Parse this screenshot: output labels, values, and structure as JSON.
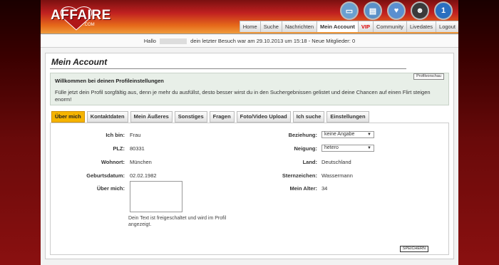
{
  "logo": {
    "text": "AFFAIRE",
    "sub": ".COM"
  },
  "top_icons": [
    {
      "icon": "monitor-icon",
      "color": "#6aa0d0"
    },
    {
      "icon": "document-icon",
      "color": "#5a90c8"
    },
    {
      "icon": "heart-icon",
      "color": "#5a8fd0"
    },
    {
      "icon": "people-icon",
      "color": "#3a3a3a"
    },
    {
      "icon": "notification-icon",
      "color": "#2a6fc0",
      "badge": "1"
    }
  ],
  "nav": [
    {
      "label": "Home"
    },
    {
      "label": "Suche"
    },
    {
      "label": "Nachrichten"
    },
    {
      "label": "Mein Account",
      "active": true
    },
    {
      "label": "VIP",
      "vip": true
    },
    {
      "label": "Community"
    },
    {
      "label": "Livedates"
    },
    {
      "label": "Logout"
    }
  ],
  "welcome": {
    "prefix": "Hallo",
    "suffix": "dein letzter Besuch war am 29.10.2013 um 15:18 - Neue Mitglieder: 0"
  },
  "page_title": "Mein Account",
  "info": {
    "title": "Willkommen bei deinen Profileinstellungen",
    "text": "Fülle jetzt dein Profil sorgfältig aus, denn je mehr du ausfüllst, desto besser wirst du in den Suchergebnissen gelistet und deine Chancen auf einen Flirt steigen enorm!",
    "preview_button": "Profilvorschau"
  },
  "tabs": [
    {
      "label": "Über mich",
      "active": true
    },
    {
      "label": "Kontaktdaten"
    },
    {
      "label": "Mein Äußeres"
    },
    {
      "label": "Sonstiges"
    },
    {
      "label": "Fragen"
    },
    {
      "label": "Foto/Video Upload"
    },
    {
      "label": "Ich suche"
    },
    {
      "label": "Einstellungen"
    }
  ],
  "form_left": [
    {
      "label": "Ich bin:",
      "value": "Frau"
    },
    {
      "label": "PLZ:",
      "value": "80331"
    },
    {
      "label": "Wohnort:",
      "value": "München"
    },
    {
      "label": "Geburtsdatum:",
      "value": "02.02.1982"
    },
    {
      "label": "Über mich:",
      "value": ""
    }
  ],
  "form_right": [
    {
      "label": "Beziehung:",
      "value": "keine Angabe"
    },
    {
      "label": "Neigung:",
      "value": "hetero"
    },
    {
      "label": "Land:",
      "value": "Deutschland"
    },
    {
      "label": "Sternzeichen:",
      "value": "Wassermann"
    },
    {
      "label": "Mein Alter:",
      "value": "34"
    }
  ],
  "about_note": "Dein Text ist freigeschaltet und wird im Profil angezeigt.",
  "save_button": "SPEICHERN"
}
